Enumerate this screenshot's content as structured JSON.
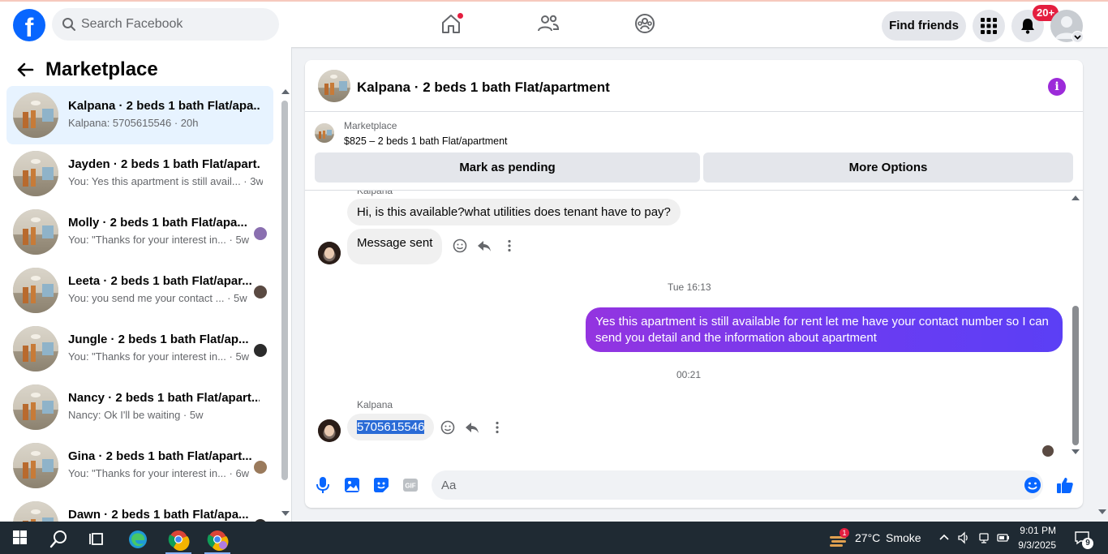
{
  "topbar": {
    "logo": "f",
    "search_placeholder": "Search Facebook",
    "find_friends_label": "Find friends",
    "notification_count": "20+",
    "colors": {
      "brand": "#0866ff",
      "badge": "#e41e3f"
    }
  },
  "sidebar": {
    "title": "Marketplace",
    "conversations": [
      {
        "title": "Kalpana · 2 beds 1 bath Flat/apa...",
        "subtitle": "Kalpana: 5705615546 · 20h"
      },
      {
        "title": "Jayden · 2 beds 1 bath Flat/apart...",
        "subtitle": "You: Yes this apartment is still avail... · 3w"
      },
      {
        "title": "Molly · 2 beds 1 bath Flat/apa...",
        "subtitle": "You: \"Thanks for your interest in... · 5w"
      },
      {
        "title": "Leeta · 2 beds 1 bath Flat/apar...",
        "subtitle": "You: you send me your contact ... · 5w"
      },
      {
        "title": "Jungle · 2 beds 1 bath Flat/ap...",
        "subtitle": "You: \"Thanks for your interest in... · 5w"
      },
      {
        "title": "Nancy · 2 beds 1 bath Flat/apart...",
        "subtitle": "Nancy: Ok I'll be waiting · 5w"
      },
      {
        "title": "Gina · 2 beds 1 bath Flat/apart...",
        "subtitle": "You: \"Thanks for your interest in... · 6w"
      },
      {
        "title": "Dawn · 2 beds 1 bath Flat/apa...",
        "subtitle": ""
      }
    ]
  },
  "chat": {
    "header_title": "Kalpana · 2 beds 1 bath Flat/apartment",
    "info_icon": "i",
    "listing_label": "Marketplace",
    "listing_price": "$825 – 2 beds 1 bath Flat/apartment",
    "mark_pending_label": "Mark as pending",
    "more_options_label": "More Options",
    "messages": {
      "sender_top": "Kalpana",
      "incoming_1": "Hi, is this available?what utilities does tenant have to pay?",
      "incoming_2": "Message sent",
      "time_1": "Tue 16:13",
      "outgoing_1": "Yes this apartment is still available for rent let me have your contact number so I can send you detail and the information about apartment",
      "time_2": "00:21",
      "sender_bottom": "Kalpana",
      "incoming_3": "5705615546"
    },
    "composer_placeholder": "Aa",
    "colors": {
      "outgoing_start": "#9434e0",
      "outgoing_end": "#5b3ff5",
      "accent": "#0866ff"
    }
  },
  "taskbar": {
    "weather_temp": "27°C",
    "weather_cond": "Smoke",
    "weather_badge": "1",
    "time": "9:01 PM",
    "date": "9/3/2025",
    "notif_count": "9"
  }
}
